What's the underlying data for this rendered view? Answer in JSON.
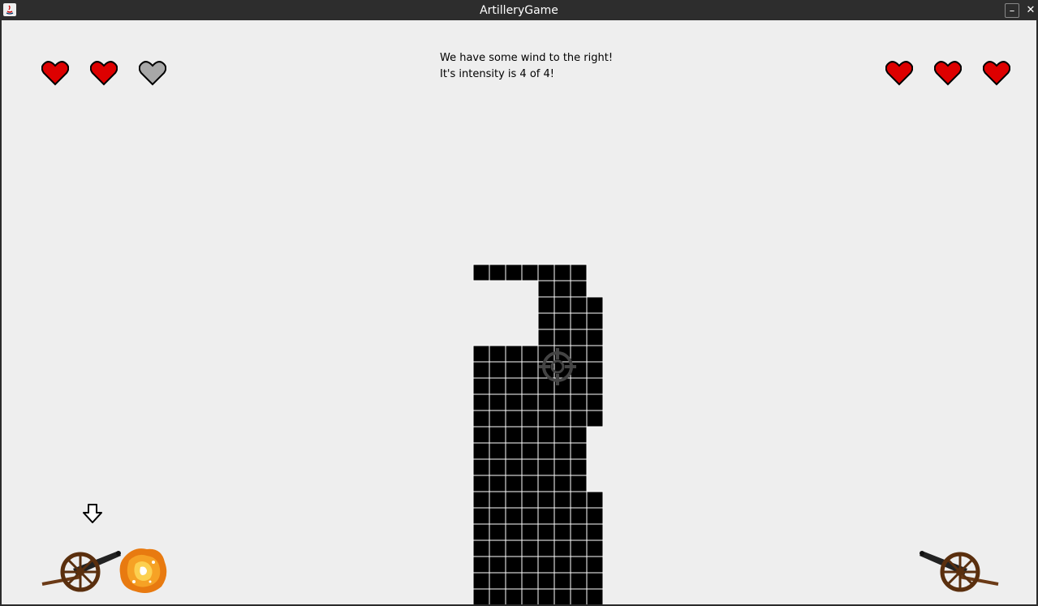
{
  "window": {
    "title": "ArtilleryGame",
    "minimize_symbol": "–",
    "close_symbol": "✕"
  },
  "hud": {
    "wind_line1": "We have some wind to the right!",
    "wind_line2": "It's intensity is 4 of 4!",
    "player_left_hearts": [
      true,
      true,
      false
    ],
    "player_right_hearts": [
      true,
      true,
      true
    ],
    "heart_colors": {
      "full": "#dd0000",
      "empty": "#a8a8a8"
    }
  },
  "icons": {
    "app": "java-icon",
    "turn_indicator": "down-arrow-icon",
    "aim": "crosshair-icon",
    "player_left": "cannon-icon",
    "player_right": "cannon-icon",
    "effect": "explosion-icon"
  }
}
